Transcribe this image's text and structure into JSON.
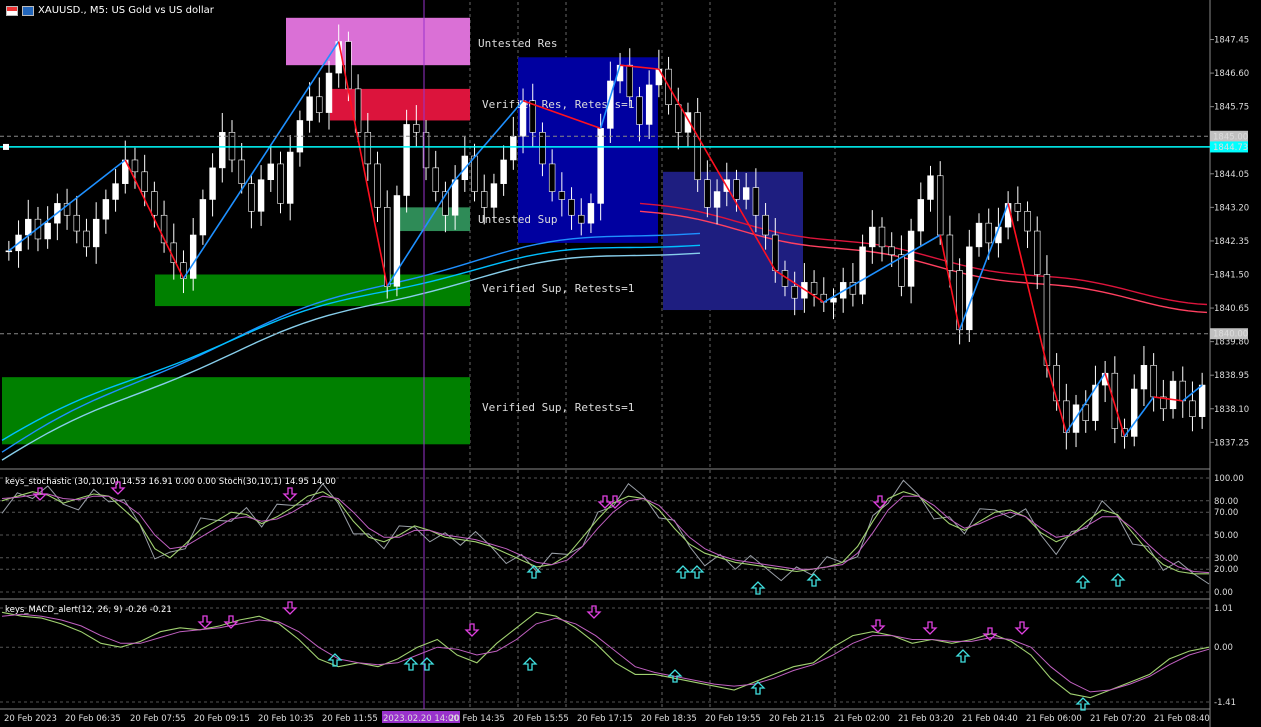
{
  "window": {
    "title": "XAUUSD., M5:  US Gold vs US dollar"
  },
  "chart_data": {
    "type": "candlestick",
    "symbol": "XAUUSD.",
    "timeframe": "M5",
    "price_axis": {
      "ylim": [
        1836.6,
        1848.4
      ],
      "ticks": [
        "1847.45",
        "1846.60",
        "1845.75",
        "1844.05",
        "1843.20",
        "1842.35",
        "1841.50",
        "1840.65",
        "1839.80",
        "1838.95",
        "1838.10",
        "1837.25"
      ],
      "tick_values": [
        1847.45,
        1846.6,
        1845.75,
        1844.05,
        1843.2,
        1842.35,
        1841.5,
        1840.65,
        1839.8,
        1838.95,
        1838.1,
        1837.25
      ],
      "badges": [
        {
          "label": "1845.00",
          "value": 1845.0,
          "color": "#c0c0c0"
        },
        {
          "label": "1844.73",
          "value": 1844.73,
          "color": "#00ffff"
        },
        {
          "label": "1840.00",
          "value": 1840.0,
          "color": "#c0c0c0"
        }
      ]
    },
    "time_axis": {
      "labels": [
        "20 Feb 2023",
        "20 Feb 06:35",
        "20 Feb 07:55",
        "20 Feb 09:15",
        "20 Feb 10:35",
        "20 Feb 11:55",
        "2023.02.20 14:00",
        "20 Feb 14:35",
        "20 Feb 15:55",
        "20 Feb 17:15",
        "20 Feb 18:35",
        "20 Feb 19:55",
        "20 Feb 21:15",
        "21 Feb 02:00",
        "21 Feb 03:20",
        "21 Feb 04:40",
        "21 Feb 06:00",
        "21 Feb 07:20",
        "21 Feb 08:40"
      ],
      "crosshair_label": "2023.02.20 14:00"
    },
    "horizontal_line": {
      "value": 1844.73,
      "color": "#00ffff"
    },
    "zones": [
      {
        "label": "Untested Res",
        "top": 1848.0,
        "bottom": 1846.8,
        "color": "#da70d6"
      },
      {
        "label": "Verified Res, Retests=1",
        "top": 1846.2,
        "bottom": 1845.4,
        "color": "#dc143c"
      },
      {
        "label": "Untested Sup",
        "top": 1843.2,
        "bottom": 1842.6,
        "color": "#2e8b57"
      },
      {
        "label": "Verified Sup, Retests=1",
        "top": 1841.5,
        "bottom": 1840.7,
        "color": "#008000"
      },
      {
        "label": "Verified Sup, Retests=1",
        "top": 1838.9,
        "bottom": 1837.2,
        "color": "#008000"
      }
    ],
    "boxes": [
      {
        "from_index": 0.43,
        "to_index": 0.545,
        "top": 1847.0,
        "bottom": 1842.3,
        "color": "#0000a0"
      },
      {
        "from_index": 0.545,
        "to_index": 0.66,
        "top": 1844.1,
        "bottom": 1840.6,
        "color": "#1e1e80"
      }
    ],
    "closes": [
      1842.1,
      1842.5,
      1842.9,
      1842.4,
      1842.8,
      1843.3,
      1843.0,
      1842.6,
      1842.2,
      1842.9,
      1843.4,
      1843.8,
      1844.4,
      1844.1,
      1843.6,
      1843.0,
      1842.3,
      1841.8,
      1841.4,
      1842.5,
      1843.4,
      1844.2,
      1845.1,
      1844.4,
      1843.8,
      1843.1,
      1843.9,
      1844.3,
      1843.3,
      1844.6,
      1845.4,
      1846.0,
      1845.6,
      1846.6,
      1847.4,
      1846.2,
      1845.1,
      1844.3,
      1843.2,
      1841.2,
      1843.5,
      1845.3,
      1845.1,
      1844.2,
      1843.6,
      1843.0,
      1843.9,
      1844.5,
      1843.6,
      1843.2,
      1843.8,
      1844.4,
      1845.0,
      1845.9,
      1845.1,
      1844.3,
      1843.6,
      1843.4,
      1843.0,
      1842.8,
      1843.3,
      1845.2,
      1846.4,
      1846.8,
      1846.0,
      1845.3,
      1846.3,
      1846.7,
      1845.8,
      1845.1,
      1845.6,
      1843.9,
      1843.2,
      1843.6,
      1843.9,
      1843.4,
      1843.7,
      1843.0,
      1842.5,
      1841.6,
      1841.2,
      1840.9,
      1841.3,
      1841.0,
      1840.8,
      1840.9,
      1841.3,
      1841.0,
      1842.2,
      1842.7,
      1842.2,
      1842.0,
      1841.2,
      1842.6,
      1843.4,
      1844.0,
      1842.5,
      1841.6,
      1840.1,
      1842.2,
      1842.8,
      1842.3,
      1842.7,
      1843.3,
      1843.1,
      1842.6,
      1841.5,
      1839.2,
      1838.3,
      1837.5,
      1838.2,
      1837.8,
      1838.7,
      1839.0,
      1837.6,
      1837.4,
      1838.6,
      1839.2,
      1838.4,
      1838.1,
      1838.8,
      1838.3,
      1837.9,
      1838.7
    ],
    "moving_averages": [
      {
        "color": "#1e90ff",
        "start": 1837.0,
        "end": 1842.6
      },
      {
        "color": "#00bfff",
        "start": 1837.3,
        "end": 1842.3
      },
      {
        "color": "#87ceeb",
        "start": 1836.8,
        "end": 1842.1
      },
      {
        "color": "#dc143c",
        "start": 1843.3,
        "end": 1840.8
      },
      {
        "color": "#ff4060",
        "start": 1843.1,
        "end": 1840.6
      }
    ],
    "stochastic": {
      "label": "keys_stochastic (30,10,10) 14.53 16.91 0.00 0.00 Stoch(30,10,1) 14.95 14.00",
      "ticks": [
        "100.00",
        "80.00",
        "70.00",
        "50.00",
        "30.00",
        "20.00",
        "0.00"
      ],
      "tick_values": [
        100,
        80,
        70,
        50,
        30,
        20,
        0
      ],
      "main": [
        80,
        84,
        88,
        85,
        78,
        82,
        86,
        84,
        72,
        60,
        38,
        30,
        42,
        55,
        62,
        70,
        68,
        60,
        66,
        74,
        84,
        88,
        80,
        62,
        48,
        44,
        50,
        58,
        54,
        48,
        46,
        44,
        40,
        34,
        28,
        22,
        24,
        32,
        48,
        64,
        78,
        84,
        82,
        72,
        56,
        42,
        34,
        30,
        26,
        24,
        22,
        20,
        18,
        20,
        22,
        26,
        40,
        62,
        82,
        88,
        84,
        72,
        60,
        54,
        62,
        70,
        72,
        66,
        52,
        44,
        50,
        62,
        72,
        68,
        52,
        36,
        24,
        18,
        16,
        16
      ],
      "signal": [
        82,
        83,
        85,
        86,
        82,
        81,
        84,
        84,
        78,
        68,
        50,
        38,
        40,
        48,
        56,
        64,
        66,
        62,
        64,
        70,
        78,
        84,
        82,
        70,
        56,
        48,
        48,
        54,
        54,
        50,
        48,
        46,
        42,
        38,
        32,
        26,
        24,
        28,
        40,
        56,
        70,
        80,
        82,
        76,
        62,
        48,
        38,
        32,
        28,
        26,
        24,
        22,
        20,
        20,
        22,
        24,
        34,
        52,
        72,
        84,
        84,
        76,
        64,
        56,
        60,
        66,
        70,
        66,
        56,
        48,
        50,
        58,
        66,
        66,
        56,
        42,
        30,
        22,
        18,
        17
      ]
    },
    "macd": {
      "label": "keys_MACD_alert(12, 26, 9) -0.26 -0.21",
      "ticks": [
        "1.01",
        "0.00",
        "-1.41"
      ],
      "tick_values": [
        1.01,
        0.0,
        -1.41
      ],
      "main": [
        0.9,
        0.8,
        0.75,
        0.6,
        0.4,
        0.1,
        0.0,
        0.15,
        0.4,
        0.5,
        0.45,
        0.55,
        0.7,
        0.8,
        0.6,
        0.2,
        -0.3,
        -0.5,
        -0.4,
        -0.5,
        -0.3,
        0.0,
        0.2,
        -0.2,
        -0.4,
        0.1,
        0.5,
        0.9,
        0.8,
        0.5,
        0.1,
        -0.4,
        -0.7,
        -0.7,
        -0.8,
        -0.9,
        -1.0,
        -1.1,
        -0.9,
        -0.7,
        -0.5,
        -0.4,
        0.0,
        0.3,
        0.4,
        0.3,
        0.1,
        0.2,
        0.1,
        0.2,
        0.35,
        0.15,
        -0.2,
        -0.8,
        -1.2,
        -1.3,
        -1.1,
        -0.9,
        -0.7,
        -0.3,
        -0.1,
        0.0
      ],
      "signal": [
        0.8,
        0.85,
        0.8,
        0.7,
        0.55,
        0.3,
        0.1,
        0.1,
        0.25,
        0.4,
        0.45,
        0.5,
        0.6,
        0.7,
        0.65,
        0.4,
        0.0,
        -0.3,
        -0.4,
        -0.45,
        -0.4,
        -0.2,
        0.0,
        -0.05,
        -0.2,
        -0.1,
        0.2,
        0.6,
        0.75,
        0.6,
        0.3,
        -0.1,
        -0.5,
        -0.65,
        -0.75,
        -0.85,
        -0.95,
        -1.0,
        -0.95,
        -0.8,
        -0.6,
        -0.45,
        -0.2,
        0.1,
        0.3,
        0.3,
        0.2,
        0.2,
        0.15,
        0.15,
        0.25,
        0.2,
        0.0,
        -0.5,
        -0.9,
        -1.15,
        -1.1,
        -0.95,
        -0.75,
        -0.45,
        -0.2,
        -0.05
      ]
    }
  }
}
